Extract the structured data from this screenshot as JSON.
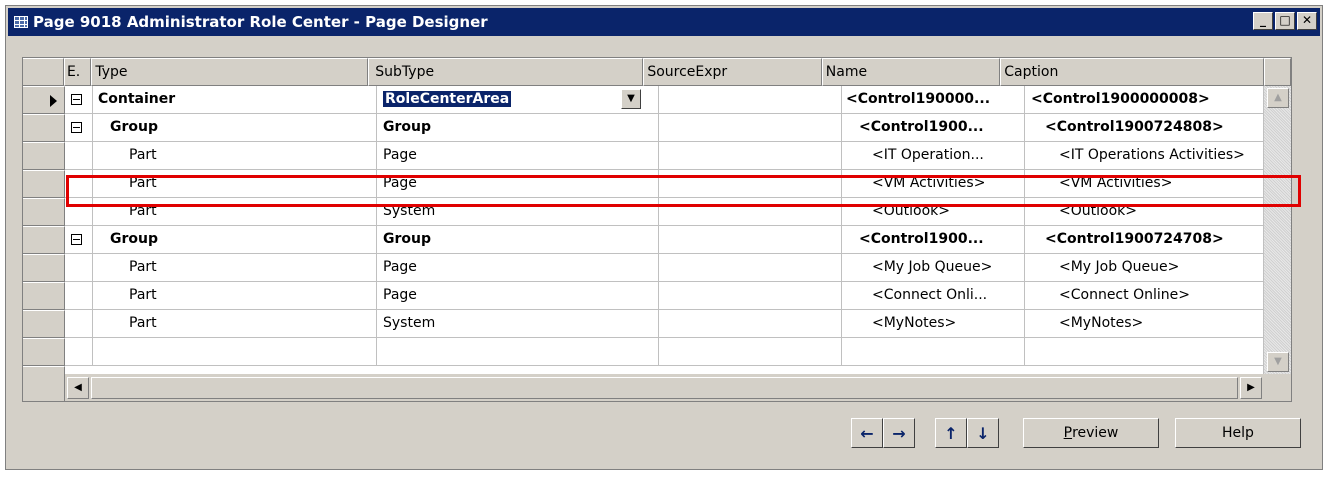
{
  "window": {
    "title": "Page 9018 Administrator Role Center - Page Designer",
    "controls": [
      "_",
      "□",
      "✕"
    ]
  },
  "grid": {
    "headers": {
      "e": "E.",
      "type": "Type",
      "subtype": "SubType",
      "source": "SourceExpr",
      "name": "Name",
      "caption": "Caption"
    },
    "rows": [
      {
        "type": "Container",
        "subtype": "RoleCenterArea",
        "name": "<Control190000...",
        "caption": "<Control1900000008>"
      },
      {
        "type": "Group",
        "subtype": "Group",
        "name": "<Control1900...",
        "caption": "<Control1900724808>"
      },
      {
        "type": "Part",
        "subtype": "Page",
        "name": "<IT Operation...",
        "caption": "<IT Operations Activities>"
      },
      {
        "type": "Part",
        "subtype": "Page",
        "name": "<VM Activities>",
        "caption": "<VM Activities>"
      },
      {
        "type": "Part",
        "subtype": "System",
        "name": "<Outlook>",
        "caption": "<Outlook>"
      },
      {
        "type": "Group",
        "subtype": "Group",
        "name": "<Control1900...",
        "caption": "<Control1900724708>"
      },
      {
        "type": "Part",
        "subtype": "Page",
        "name": "<My Job Queue>",
        "caption": "<My Job Queue>"
      },
      {
        "type": "Part",
        "subtype": "Page",
        "name": "<Connect Onli...",
        "caption": "<Connect Online>"
      },
      {
        "type": "Part",
        "subtype": "System",
        "name": "<MyNotes>",
        "caption": "<MyNotes>"
      }
    ]
  },
  "buttons": {
    "left": "←",
    "right": "→",
    "up": "↑",
    "down": "↓",
    "preview_u": "P",
    "preview_rest": "review",
    "help": "Help"
  }
}
